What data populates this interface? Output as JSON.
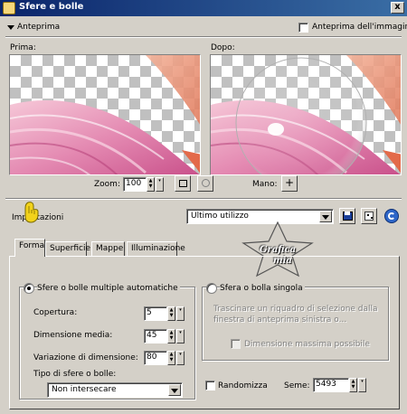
{
  "window": {
    "title": "Sfere e bolle",
    "close_label": "x"
  },
  "preview_bar": {
    "toggle_label": "Anteprima",
    "image_preview_label": "Anteprima dell'immagine"
  },
  "panes": {
    "before_label": "Prima:",
    "after_label": "Dopo:"
  },
  "zoom": {
    "label": "Zoom:",
    "value": "100"
  },
  "pan": {
    "label": "Mano:"
  },
  "presets": {
    "label": "Impostazioni",
    "selected": "Ultimo utilizzo"
  },
  "watermark": {
    "line1": "Grafica",
    "line2": "mia"
  },
  "tabs": [
    {
      "label": "Forma"
    },
    {
      "label": "Superficie"
    },
    {
      "label": "Mappe"
    },
    {
      "label": "Illuminazione"
    }
  ],
  "form": {
    "auto_label": "Sfere o bolle multiple automatiche",
    "single_label": "Sfera o bolla singola",
    "single_help": "Trascinare un riquadro di selezione dalla finestra di anteprima sinistra o...",
    "max_size_label": "Dimensione massima possibile",
    "coverage": {
      "label": "Copertura:",
      "value": "5"
    },
    "avg_size": {
      "label": "Dimensione media:",
      "value": "45"
    },
    "size_var": {
      "label": "Variazione di dimensione:",
      "value": "80"
    },
    "type": {
      "label": "Tipo di sfere o bolle:",
      "selected": "Non intersecare"
    },
    "randomize_label": "Randomizza",
    "seed": {
      "label": "Seme:",
      "value": "5493"
    }
  }
}
